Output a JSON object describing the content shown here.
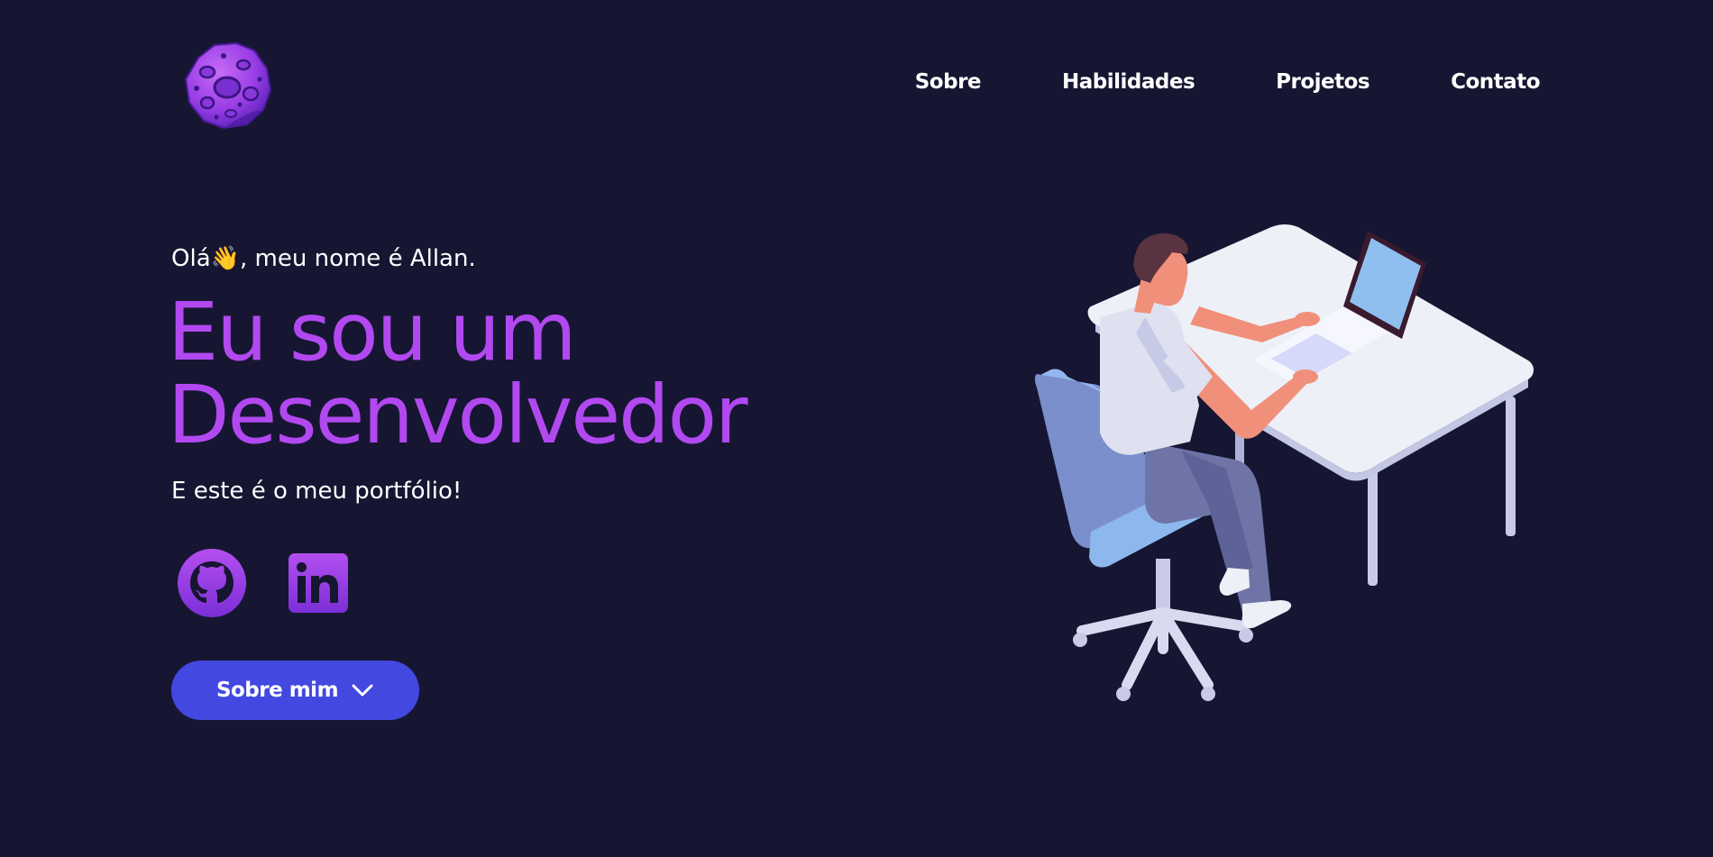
{
  "nav": {
    "items": [
      {
        "label": "Sobre"
      },
      {
        "label": "Habilidades"
      },
      {
        "label": "Projetos"
      },
      {
        "label": "Contato"
      }
    ]
  },
  "hero": {
    "greeting": "Olá👋, meu nome é Allan.",
    "headline_line1": "Eu sou um",
    "headline_line2": "Desenvolvedor",
    "subtitle": "E este é o meu portfólio!",
    "cta_label": "Sobre mim"
  },
  "social": {
    "github": "github-icon",
    "linkedin": "linkedin-icon"
  },
  "colors": {
    "background": "#161632",
    "accent_purple": "#b249f0",
    "button_blue": "#4348e0",
    "text": "#ffffff"
  }
}
